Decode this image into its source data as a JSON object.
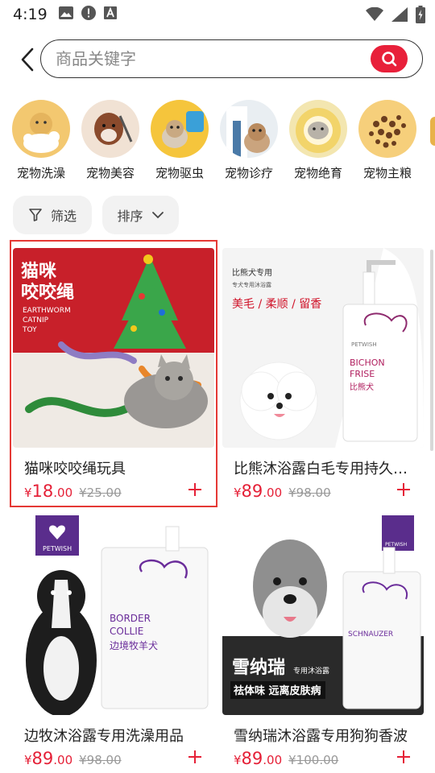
{
  "status_bar": {
    "time": "4:19"
  },
  "search": {
    "placeholder": "商品关键字",
    "value": ""
  },
  "categories": [
    {
      "label": "宠物洗澡"
    },
    {
      "label": "宠物美容"
    },
    {
      "label": "宠物驱虫"
    },
    {
      "label": "宠物诊疗"
    },
    {
      "label": "宠物绝育"
    },
    {
      "label": "宠物主粮"
    }
  ],
  "filters": {
    "filter_label": "筛选",
    "sort_label": "排序"
  },
  "products": [
    {
      "title": "猫咪咬咬绳玩具",
      "currency": "¥",
      "price_int": "18",
      "price_dec": ".00",
      "old_price": "¥25.00",
      "image_text": {
        "heading": "猫咪\n咬咬绳",
        "sub": "EARTHWORM\nCATNIP\nTOY"
      }
    },
    {
      "title": "比熊沐浴露白毛专用持久留香",
      "currency": "¥",
      "price_int": "89",
      "price_dec": ".00",
      "old_price": "¥98.00",
      "image_text": {
        "tag": "比熊犬专用",
        "sub": "专犬专用沐浴露",
        "slogan": "美毛 / 柔顺 / 留香",
        "brand": "PETWISH",
        "name_en": "BICHON\nFRISE",
        "name_cn": "比熊犬"
      }
    },
    {
      "title": "边牧沐浴露专用洗澡用品",
      "currency": "¥",
      "price_int": "89",
      "price_dec": ".00",
      "old_price": "¥98.00",
      "image_text": {
        "brand": "PETWISH",
        "name_en": "BORDER\nCOLLIE",
        "name_cn": "边境牧羊犬"
      }
    },
    {
      "title": "雪纳瑞沐浴露专用狗狗香波",
      "currency": "¥",
      "price_int": "89",
      "price_dec": ".00",
      "old_price": "¥100.00",
      "image_text": {
        "brand": "PETWISH",
        "name_cn": "雪纳瑞",
        "sub": "专用沐浴露",
        "banner": "祛体味 远离皮肤病",
        "name_en": "SCHNAUZER"
      }
    }
  ],
  "colors": {
    "accent": "#e8203a",
    "price": "#e52037",
    "chip_bg": "#f2f2f2",
    "selected_border": "#e53935"
  }
}
